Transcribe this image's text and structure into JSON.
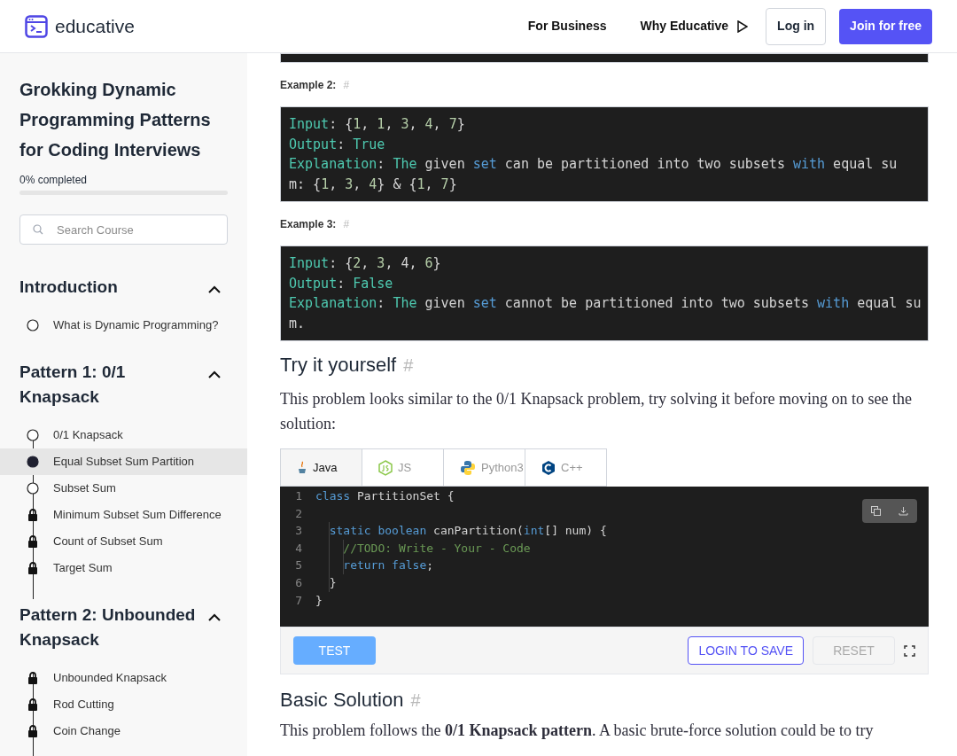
{
  "header": {
    "logo": "educative",
    "nav": [
      {
        "label": "For Business",
        "kind": "link"
      },
      {
        "label": "Why Educative",
        "kind": "play"
      }
    ],
    "login": "Log in",
    "join": "Join for free"
  },
  "sidebar": {
    "course_title": "Grokking Dynamic Programming Patterns for Coding Interviews",
    "progress_label": "0% completed",
    "progress": {
      "level": 0
    },
    "search": {
      "placeholder": "Search Course"
    },
    "sections": [
      {
        "title": "Introduction",
        "expanded": true,
        "lessons": [
          {
            "title": "What is Dynamic Programming?",
            "kind": "open",
            "selected": false
          }
        ]
      },
      {
        "title": "Pattern 1: 0/1 Knapsack",
        "expanded": true,
        "lessons": [
          {
            "title": "0/1 Knapsack",
            "kind": "open",
            "selected": false
          },
          {
            "title": "Equal Subset Sum Partition",
            "kind": "current",
            "selected": true
          },
          {
            "title": "Subset Sum",
            "kind": "open",
            "selected": false
          },
          {
            "title": "Minimum Subset Sum Difference",
            "kind": "locked",
            "selected": false
          },
          {
            "title": "Count of Subset Sum",
            "kind": "locked",
            "selected": false
          },
          {
            "title": "Target Sum",
            "kind": "locked",
            "selected": false
          }
        ]
      },
      {
        "title": "Pattern 2: Unbounded Knapsack",
        "expanded": true,
        "lessons": [
          {
            "title": "Unbounded Knapsack",
            "kind": "locked",
            "selected": false
          },
          {
            "title": "Rod Cutting",
            "kind": "locked",
            "selected": false
          },
          {
            "title": "Coin Change",
            "kind": "locked",
            "selected": false
          }
        ]
      }
    ]
  },
  "content": {
    "examples": [
      {
        "label": "Example 2:",
        "anchor": "#",
        "lines": [
          [
            {
              "t": "Input",
              "kind": "label"
            },
            {
              "t": ": {",
              "kind": "plain"
            },
            {
              "t": "1",
              "kind": "num"
            },
            {
              "t": ", ",
              "kind": "plain"
            },
            {
              "t": "1",
              "kind": "num"
            },
            {
              "t": ", ",
              "kind": "plain"
            },
            {
              "t": "3",
              "kind": "num"
            },
            {
              "t": ", ",
              "kind": "plain"
            },
            {
              "t": "4",
              "kind": "num"
            },
            {
              "t": ", ",
              "kind": "plain"
            },
            {
              "t": "7",
              "kind": "num"
            },
            {
              "t": "}",
              "kind": "plain"
            }
          ],
          [
            {
              "t": "Output",
              "kind": "label"
            },
            {
              "t": ": ",
              "kind": "plain"
            },
            {
              "t": "True",
              "kind": "label"
            }
          ],
          [
            {
              "t": "Explanation",
              "kind": "label"
            },
            {
              "t": ": ",
              "kind": "plain"
            },
            {
              "t": "The",
              "kind": "label"
            },
            {
              "t": " given ",
              "kind": "plain"
            },
            {
              "t": "set",
              "kind": "kw"
            },
            {
              "t": " can be partitioned into two subsets ",
              "kind": "plain"
            },
            {
              "t": "with",
              "kind": "kw"
            },
            {
              "t": " equal su",
              "kind": "plain"
            }
          ],
          [
            {
              "t": "m: {",
              "kind": "plain"
            },
            {
              "t": "1",
              "kind": "num"
            },
            {
              "t": ", ",
              "kind": "plain"
            },
            {
              "t": "3",
              "kind": "num"
            },
            {
              "t": ", ",
              "kind": "plain"
            },
            {
              "t": "4",
              "kind": "num"
            },
            {
              "t": "} & {",
              "kind": "plain"
            },
            {
              "t": "1",
              "kind": "num"
            },
            {
              "t": ", ",
              "kind": "plain"
            },
            {
              "t": "7",
              "kind": "num"
            },
            {
              "t": "}",
              "kind": "plain"
            }
          ]
        ]
      },
      {
        "label": "Example 3:",
        "anchor": "#",
        "lines": [
          [
            {
              "t": "Input",
              "kind": "label"
            },
            {
              "t": ": {",
              "kind": "plain"
            },
            {
              "t": "2",
              "kind": "num"
            },
            {
              "t": ", ",
              "kind": "plain"
            },
            {
              "t": "3",
              "kind": "num"
            },
            {
              "t": ", ",
              "kind": "plain"
            },
            {
              "t": "4",
              "kind": "plain"
            },
            {
              "t": ", ",
              "kind": "plain"
            },
            {
              "t": "6",
              "kind": "num"
            },
            {
              "t": "}",
              "kind": "plain"
            }
          ],
          [
            {
              "t": "Output",
              "kind": "label"
            },
            {
              "t": ": ",
              "kind": "plain"
            },
            {
              "t": "False",
              "kind": "label"
            }
          ],
          [
            {
              "t": "Explanation",
              "kind": "label"
            },
            {
              "t": ": ",
              "kind": "plain"
            },
            {
              "t": "The",
              "kind": "label"
            },
            {
              "t": " given ",
              "kind": "plain"
            },
            {
              "t": "set",
              "kind": "kw"
            },
            {
              "t": " cannot be partitioned into two subsets ",
              "kind": "plain"
            },
            {
              "t": "with",
              "kind": "kw"
            },
            {
              "t": " equal su",
              "kind": "plain"
            }
          ],
          [
            {
              "t": "m.",
              "kind": "plain"
            }
          ]
        ]
      }
    ],
    "try_heading": "Try it yourself",
    "try_anchor": "#",
    "try_text": "This problem looks similar to the 0/1 Knapsack problem, try solving it before moving on to see the solution:",
    "editor": {
      "tabs": [
        {
          "label": "Java",
          "kind": "java",
          "selected": true
        },
        {
          "label": "JS",
          "kind": "js",
          "selected": false
        },
        {
          "label": "Python3",
          "kind": "python",
          "selected": false
        },
        {
          "label": "C++",
          "kind": "cpp",
          "selected": false
        }
      ],
      "code": [
        {
          "num": "1",
          "tokens": [
            {
              "t": "class",
              "kind": "kw"
            },
            {
              "t": " PartitionSet {",
              "kind": "plain"
            }
          ]
        },
        {
          "num": "2"
        },
        {
          "num": "3",
          "tokens": [
            {
              "t": "  static",
              "kind": "kw"
            },
            {
              "t": " boolean",
              "kind": "kw"
            },
            {
              "t": " canPartition(",
              "kind": "plain"
            },
            {
              "t": "int",
              "kind": "kw"
            },
            {
              "t": "[] num) {",
              "kind": "plain"
            }
          ]
        },
        {
          "num": "4",
          "tokens": [
            {
              "t": "    //TODO: Write - Your - Code",
              "kind": "comment"
            }
          ]
        },
        {
          "num": "5",
          "tokens": [
            {
              "t": "    return",
              "kind": "kw"
            },
            {
              "t": " false",
              "kind": "kw"
            },
            {
              "t": ";",
              "kind": "plain"
            }
          ]
        },
        {
          "num": "6",
          "tokens": [
            {
              "t": "  }",
              "kind": "plain"
            }
          ]
        },
        {
          "num": "7",
          "tokens": [
            {
              "t": "}",
              "kind": "plain"
            }
          ]
        }
      ],
      "test": "TEST",
      "save": "LOGIN TO SAVE",
      "reset": "RESET"
    },
    "solution_heading": "Basic Solution",
    "solution_anchor": "#",
    "solution_text": "This problem follows the **0/1 Knapsack pattern**. A basic brute-force solution could be to try"
  }
}
